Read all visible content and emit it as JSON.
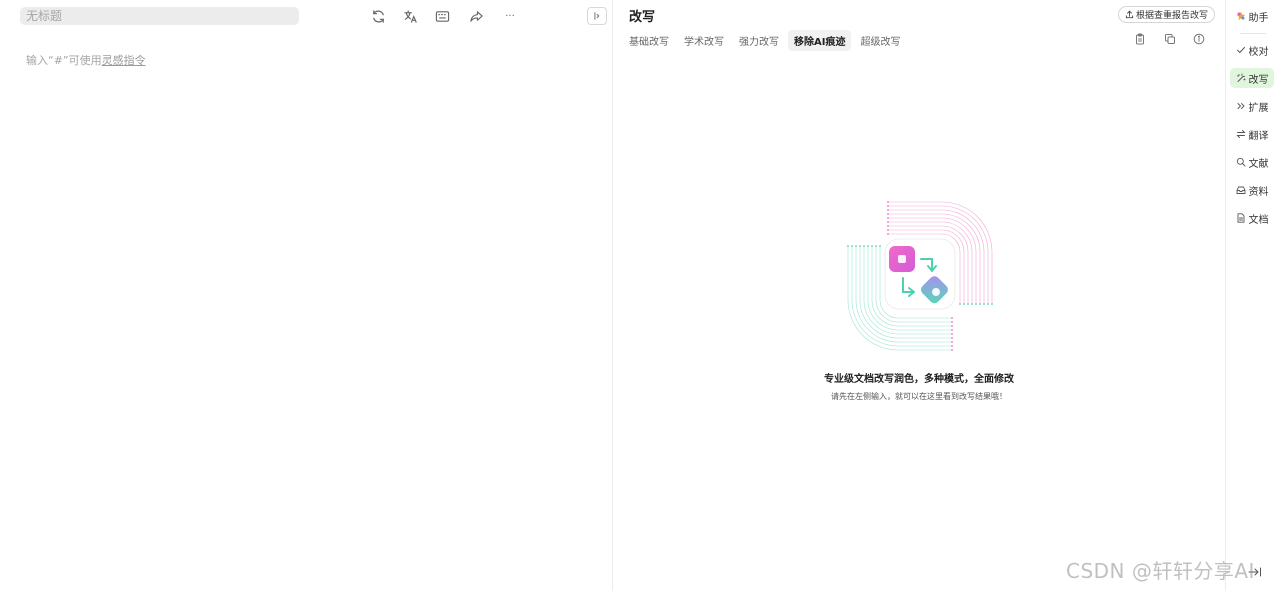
{
  "editor": {
    "title_placeholder": "无标题",
    "hint_prefix": "输入“#”可使用",
    "hint_link": "灵感指令"
  },
  "toolbar": {
    "icons": [
      "refresh-icon",
      "translate-icon",
      "keyboard-icon",
      "share-icon",
      "more-icon"
    ],
    "more_label": "···"
  },
  "panel": {
    "title": "改写",
    "report_button": "根据查重报告改写",
    "tabs": [
      {
        "label": "基础改写",
        "active": false
      },
      {
        "label": "学术改写",
        "active": false
      },
      {
        "label": "强力改写",
        "active": false
      },
      {
        "label": "移除AI痕迹",
        "active": true
      },
      {
        "label": "超级改写",
        "active": false
      }
    ],
    "icons": [
      "clipboard-icon",
      "copy-icon",
      "info-icon"
    ],
    "empty_title": "专业级文档改写润色，多种模式，全面修改",
    "empty_desc": "请先在左侧输入，就可以在这里看到改写结果哦！"
  },
  "sidebar": {
    "items": [
      {
        "label": "助手",
        "icon": "assistant-icon",
        "active": false
      },
      {
        "label": "校对",
        "icon": "check-icon",
        "active": false
      },
      {
        "label": "改写",
        "icon": "rewrite-icon",
        "active": true
      },
      {
        "label": "扩展",
        "icon": "expand-icon",
        "active": false
      },
      {
        "label": "翻译",
        "icon": "swap-icon",
        "active": false
      },
      {
        "label": "文献",
        "icon": "search-icon",
        "active": false
      },
      {
        "label": "资料",
        "icon": "inbox-icon",
        "active": false
      },
      {
        "label": "文档",
        "icon": "document-icon",
        "active": false
      }
    ]
  },
  "watermark": "CSDN @轩轩分享AI",
  "colors": {
    "active_green": "#dff5dc",
    "pink": "#e85bb5",
    "teal": "#5ed1b7"
  }
}
